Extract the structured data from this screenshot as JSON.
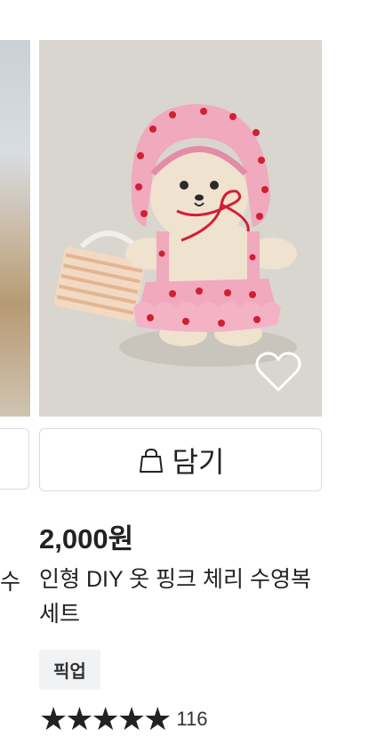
{
  "left_card": {
    "title_fragment": "수"
  },
  "product": {
    "cart_label": "담기",
    "price": "2,000원",
    "title": "인형 DIY 옷 핑크 체리 수영복 세트",
    "badge": "픽업",
    "stars": "★★★★★",
    "review_count": "116"
  },
  "icons": {
    "bag": "shopping-bag-icon",
    "heart": "heart-icon"
  },
  "colors": {
    "dress_pink": "#f0a9bd",
    "cherry_red": "#d11f33",
    "background_gray": "#d9d6cf"
  }
}
